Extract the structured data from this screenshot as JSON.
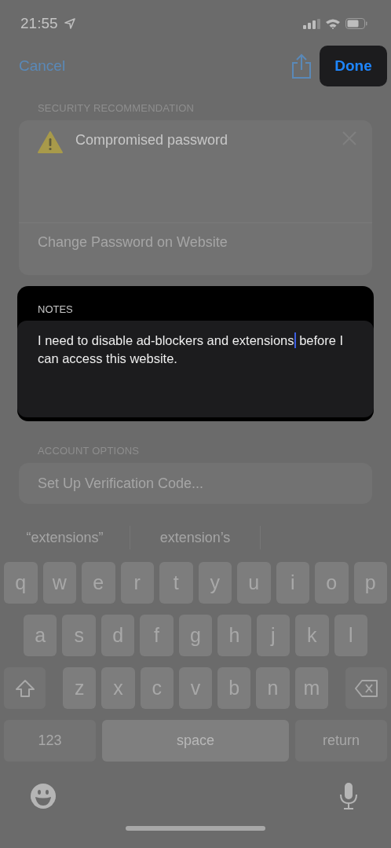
{
  "status_bar": {
    "time": "21:55"
  },
  "nav": {
    "cancel": "Cancel",
    "done": "Done",
    "done_highlighted": true
  },
  "security": {
    "header": "SECURITY RECOMMENDATION",
    "title": "Compromised password",
    "action": "Change Password on Website"
  },
  "notes": {
    "header": "NOTES",
    "text_before_cursor": "I need to disable ad-blockers and extensions",
    "text_after_cursor": " before I can access this website.",
    "highlighted": true
  },
  "account": {
    "header": "ACCOUNT OPTIONS",
    "action": "Set Up Verification Code..."
  },
  "keyboard": {
    "suggestions": [
      "“extensions”",
      "extension’s"
    ],
    "rows": [
      [
        "q",
        "w",
        "e",
        "r",
        "t",
        "y",
        "u",
        "i",
        "o",
        "p"
      ],
      [
        "a",
        "s",
        "d",
        "f",
        "g",
        "h",
        "j",
        "k",
        "l"
      ],
      [
        "z",
        "x",
        "c",
        "v",
        "b",
        "n",
        "m"
      ]
    ],
    "numbers_key": "123",
    "space_key": "space",
    "return_key": "return"
  }
}
